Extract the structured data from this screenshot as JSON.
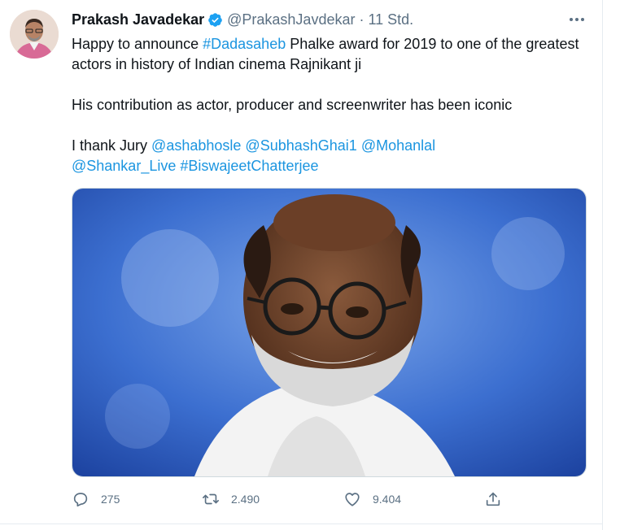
{
  "author": {
    "name": "Prakash Javadekar",
    "handle": "@PrakashJavdekar",
    "separator": "·",
    "time": "11 Std."
  },
  "tweet": {
    "para1_before": "Happy to announce ",
    "para1_hashtag": "#Dadasaheb",
    "para1_after": " Phalke award for 2019 to one of the greatest actors in history of Indian cinema Rajnikant ji",
    "para2": "His contribution as actor, producer and screenwriter has been iconic",
    "para3_prefix": "I thank Jury ",
    "mention1": "@ashabhosle",
    "mention2": "@SubhashGhai1",
    "mention3": "@Mohanlal",
    "mention4": "@Shankar_Live",
    "hashtag2": "#BiswajeetChatterjee"
  },
  "actions": {
    "replies": "275",
    "retweets": "2.490",
    "likes": "9.404"
  },
  "icons": {
    "verified": "verified-badge-icon",
    "more": "more-options-icon",
    "reply": "reply-icon",
    "retweet": "retweet-icon",
    "like": "heart-icon",
    "share": "share-icon"
  },
  "colors": {
    "link": "#1b95e0",
    "muted": "#5b7083",
    "verified": "#1da1f2"
  }
}
